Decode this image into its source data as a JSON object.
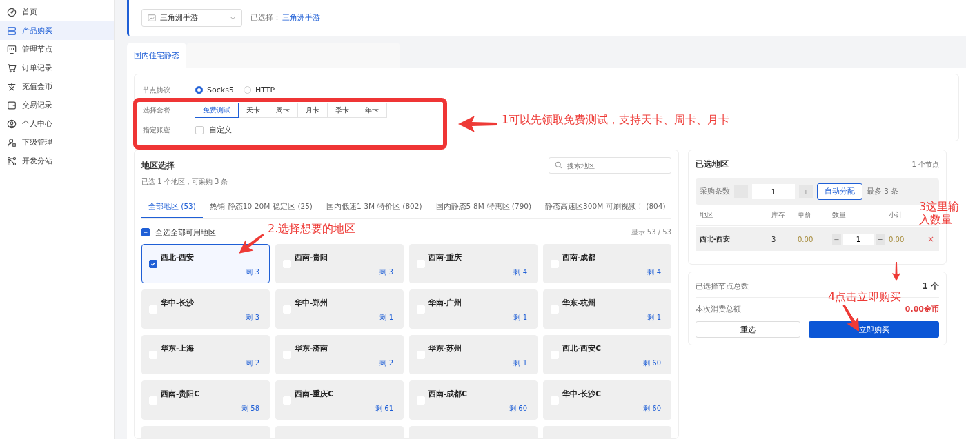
{
  "sidebar": {
    "items": [
      {
        "label": "首页",
        "selected": false
      },
      {
        "label": "产品购买",
        "selected": true
      },
      {
        "label": "管理节点",
        "selected": false
      },
      {
        "label": "订单记录",
        "selected": false
      },
      {
        "label": "充值金币",
        "selected": false
      },
      {
        "label": "交易记录",
        "selected": false
      },
      {
        "label": "个人中心",
        "selected": false
      },
      {
        "label": "下级管理",
        "selected": false
      },
      {
        "label": "开发分站",
        "selected": false
      }
    ]
  },
  "header": {
    "game_select": {
      "value": "三角洲手游"
    },
    "selected_label": "已选择：",
    "selected_value": "三角洲手游"
  },
  "tabs": [
    {
      "label": "国内住宅静态",
      "selected": true
    }
  ],
  "config": {
    "protocol": {
      "label": "节点协议",
      "options": [
        {
          "label": "Socks5",
          "selected": true
        },
        {
          "label": "HTTP",
          "selected": false
        }
      ]
    },
    "plan": {
      "label": "选择套餐",
      "options": [
        {
          "label": "免费测试",
          "selected": true
        },
        {
          "label": "天卡",
          "selected": false
        },
        {
          "label": "周卡",
          "selected": false
        },
        {
          "label": "月卡",
          "selected": false
        },
        {
          "label": "季卡",
          "selected": false
        },
        {
          "label": "年卡",
          "selected": false
        }
      ]
    },
    "account": {
      "label": "指定账密",
      "option": "自定义",
      "checked": false
    }
  },
  "regions": {
    "title": "地区选择",
    "subtitle": "已选 1 个地区，可采购 3 条",
    "search": {
      "placeholder": "搜索地区"
    },
    "tabs": [
      {
        "label": "全部地区 (53)",
        "selected": true
      },
      {
        "label": "热销-静态10-20M-稳定区 (25)",
        "selected": false
      },
      {
        "label": "国内低速1-3M-特价区 (802)",
        "selected": false
      },
      {
        "label": "国内静态5-8M-特惠区 (790)",
        "selected": false
      },
      {
        "label": "静态高速区300M-可刷视频！ (804)",
        "selected": false
      }
    ],
    "select_all": {
      "label": "全选全部可用地区",
      "indeterminate": true
    },
    "shown": "显示 53 / 53",
    "cards": [
      {
        "name": "西北-西安",
        "remaining": "剩 3",
        "selected": true
      },
      {
        "name": "西南-贵阳",
        "remaining": "剩 3",
        "selected": false
      },
      {
        "name": "西南-重庆",
        "remaining": "剩 4",
        "selected": false
      },
      {
        "name": "西南-成都",
        "remaining": "剩 4",
        "selected": false
      },
      {
        "name": "华中-长沙",
        "remaining": "剩 3",
        "selected": false
      },
      {
        "name": "华中-郑州",
        "remaining": "剩 1",
        "selected": false
      },
      {
        "name": "华南-广州",
        "remaining": "剩 1",
        "selected": false
      },
      {
        "name": "华东-杭州",
        "remaining": "剩 1",
        "selected": false
      },
      {
        "name": "华东-上海",
        "remaining": "剩 2",
        "selected": false
      },
      {
        "name": "华东-济南",
        "remaining": "剩 2",
        "selected": false
      },
      {
        "name": "华东-苏州",
        "remaining": "剩 1",
        "selected": false
      },
      {
        "name": "西北-西安C",
        "remaining": "剩 60",
        "selected": false
      },
      {
        "name": "西南-贵阳C",
        "remaining": "剩 58",
        "selected": false
      },
      {
        "name": "西南-重庆C",
        "remaining": "剩 61",
        "selected": false
      },
      {
        "name": "西南-成都C",
        "remaining": "剩 60",
        "selected": false
      },
      {
        "name": "华中-长沙C",
        "remaining": "剩 60",
        "selected": false
      }
    ]
  },
  "selected_panel": {
    "title": "已选地区",
    "count": "1 个节点",
    "quantity": {
      "label": "采购条数",
      "minus": "−",
      "value": "1",
      "plus": "+",
      "auto_button": "自动分配",
      "max_text": "最多 3 条"
    },
    "columns": [
      "地区",
      "库存",
      "单价",
      "数量",
      "小计"
    ],
    "rows": [
      {
        "region": "西北-西安",
        "stock": "3",
        "price": "0.00",
        "minus": "−",
        "quantity": "1",
        "plus": "+",
        "subtotal": "0.00",
        "remove": "×"
      }
    ]
  },
  "summary": {
    "total_label": "已选择节点总数",
    "total_value": "1 个",
    "cost_label": "本次消费总额",
    "cost_value": "0.00金币",
    "reset_button": "重选",
    "buy_button": "立即购买"
  },
  "annotations": [
    {
      "text": "1可以先领取免费测试，支持天卡、周卡、月卡"
    },
    {
      "text": "2.选择想要的地区"
    },
    {
      "text": "3这里输入数量"
    },
    {
      "text": "4点击立即购买"
    }
  ]
}
